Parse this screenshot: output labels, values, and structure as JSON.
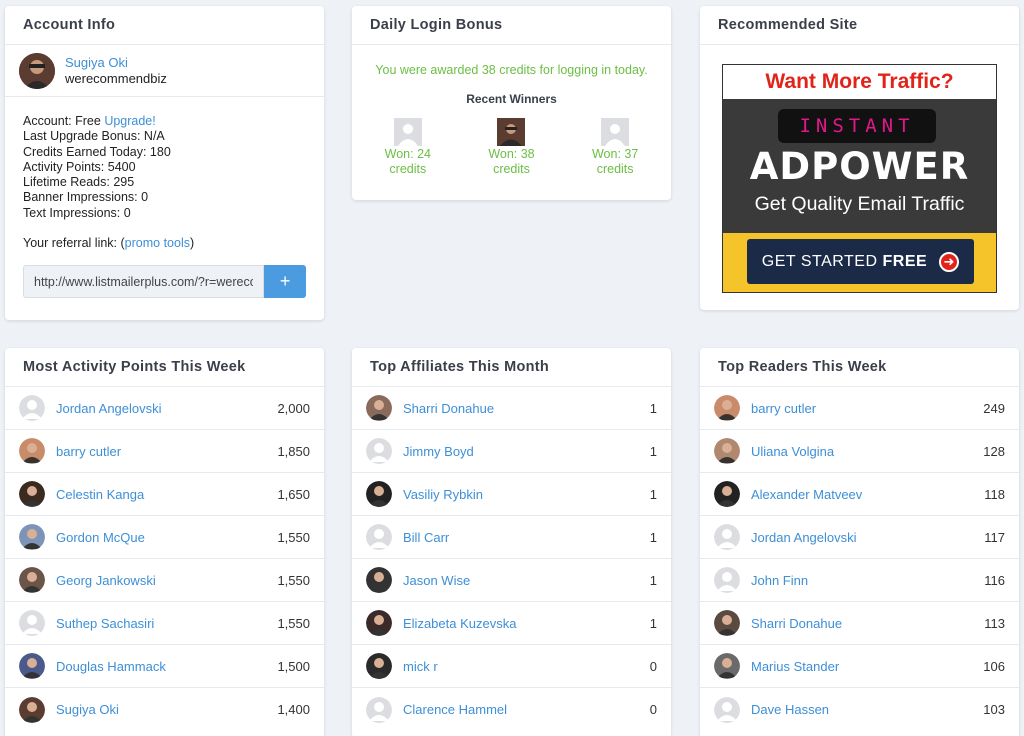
{
  "account": {
    "title": "Account Info",
    "username": "Sugiya Oki",
    "handle": "werecommendbiz",
    "account_type_label": "Account: Free",
    "upgrade_link": "Upgrade!",
    "last_upgrade_bonus": "Last Upgrade Bonus: N/A",
    "credits_today": "Credits Earned Today: 180",
    "activity_points": "Activity Points: 5400",
    "lifetime_reads": "Lifetime Reads: 295",
    "banner_impressions": "Banner Impressions: 0",
    "text_impressions": "Text Impressions: 0",
    "referral_prefix": "Your referral link: (",
    "promo_tools": "promo tools",
    "referral_suffix": ")",
    "referral_url": "http://www.listmailerplus.com/?r=werecommendbiz",
    "add_button": "+"
  },
  "bonus": {
    "title": "Daily Login Bonus",
    "message": "You were awarded 38 credits for logging in today.",
    "winners_title": "Recent Winners",
    "winners": [
      {
        "won": "Won: 24",
        "credits": "credits"
      },
      {
        "won": "Won: 38",
        "credits": "credits"
      },
      {
        "won": "Won: 37",
        "credits": "credits"
      }
    ]
  },
  "recommended": {
    "title": "Recommended Site",
    "ad_headline": "Want More Traffic?",
    "ad_instant": "INSTANT",
    "ad_brand": "ADPOWER",
    "ad_tagline": "Get Quality Email Traffic",
    "ad_cta_regular": "GET STARTED",
    "ad_cta_bold": "FREE"
  },
  "activity": {
    "title": "Most Activity Points This Week",
    "rows": [
      {
        "name": "Jordan Angelovski",
        "value": "2,000"
      },
      {
        "name": "barry cutler",
        "value": "1,850"
      },
      {
        "name": "Celestin Kanga",
        "value": "1,650"
      },
      {
        "name": "Gordon McQue",
        "value": "1,550"
      },
      {
        "name": "Georg Jankowski",
        "value": "1,550"
      },
      {
        "name": "Suthep Sachasiri",
        "value": "1,550"
      },
      {
        "name": "Douglas Hammack",
        "value": "1,500"
      },
      {
        "name": "Sugiya Oki",
        "value": "1,400"
      }
    ]
  },
  "affiliates": {
    "title": "Top Affiliates This Month",
    "rows": [
      {
        "name": "Sharri Donahue",
        "value": "1"
      },
      {
        "name": "Jimmy Boyd",
        "value": "1"
      },
      {
        "name": "Vasiliy Rybkin",
        "value": "1"
      },
      {
        "name": "Bill Carr",
        "value": "1"
      },
      {
        "name": "Jason Wise",
        "value": "1"
      },
      {
        "name": "Elizabeta Kuzevska",
        "value": "1"
      },
      {
        "name": "mick r",
        "value": "0"
      },
      {
        "name": "Clarence Hammel",
        "value": "0"
      }
    ]
  },
  "readers": {
    "title": "Top Readers This Week",
    "rows": [
      {
        "name": "barry cutler",
        "value": "249"
      },
      {
        "name": "Uliana Volgina",
        "value": "128"
      },
      {
        "name": "Alexander Matveev",
        "value": "118"
      },
      {
        "name": "Jordan Angelovski",
        "value": "117"
      },
      {
        "name": "John Finn",
        "value": "116"
      },
      {
        "name": "Sharri Donahue",
        "value": "113"
      },
      {
        "name": "Marius Stander",
        "value": "106"
      },
      {
        "name": "Dave Hassen",
        "value": "103"
      }
    ]
  },
  "colors": {
    "accent_blue": "#3d8fd6",
    "success_green": "#6cbe45",
    "page_bg": "#eef2f6"
  }
}
